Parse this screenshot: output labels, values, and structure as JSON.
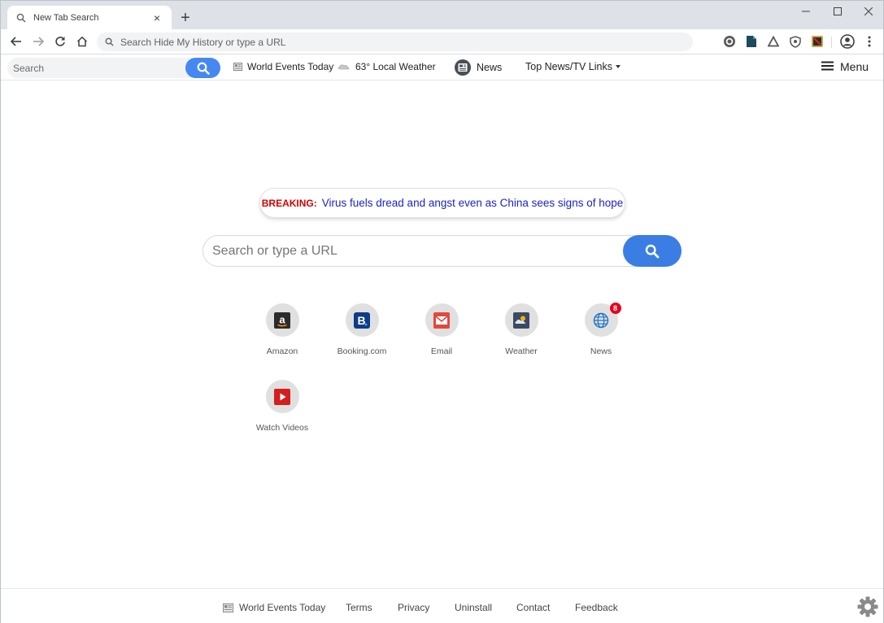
{
  "browser": {
    "tab_title": "New Tab Search",
    "new_tab_symbol": "+",
    "close_tab_symbol": "×",
    "omnibox_placeholder": "Search Hide My History or type a URL"
  },
  "topbar": {
    "search_placeholder": "Search",
    "world_events": "World Events Today",
    "weather": "63° Local Weather",
    "news": "News",
    "top_news": "Top News/TV Links",
    "menu": "Menu"
  },
  "breaking": {
    "label": "BREAKING:",
    "headline": "Virus fuels dread and angst even as China sees signs of hope"
  },
  "main_search": {
    "placeholder": "Search or type a URL"
  },
  "tiles": [
    {
      "label": "Amazon",
      "icon": "amazon-icon"
    },
    {
      "label": "Booking.com",
      "icon": "booking-icon"
    },
    {
      "label": "Email",
      "icon": "email-icon"
    },
    {
      "label": "Weather",
      "icon": "weather-icon"
    },
    {
      "label": "News",
      "icon": "globe-icon",
      "badge": "8"
    },
    {
      "label": "Watch Videos",
      "icon": "play-icon"
    }
  ],
  "footer": {
    "world_events": "World Events Today",
    "terms": "Terms",
    "privacy": "Privacy",
    "uninstall": "Uninstall",
    "contact": "Contact",
    "feedback": "Feedback"
  },
  "colors": {
    "accent_blue": "#3a7ee4",
    "breaking_red": "#d50000",
    "headline_blue": "#1a24c7",
    "badge_red": "#e8001c"
  }
}
